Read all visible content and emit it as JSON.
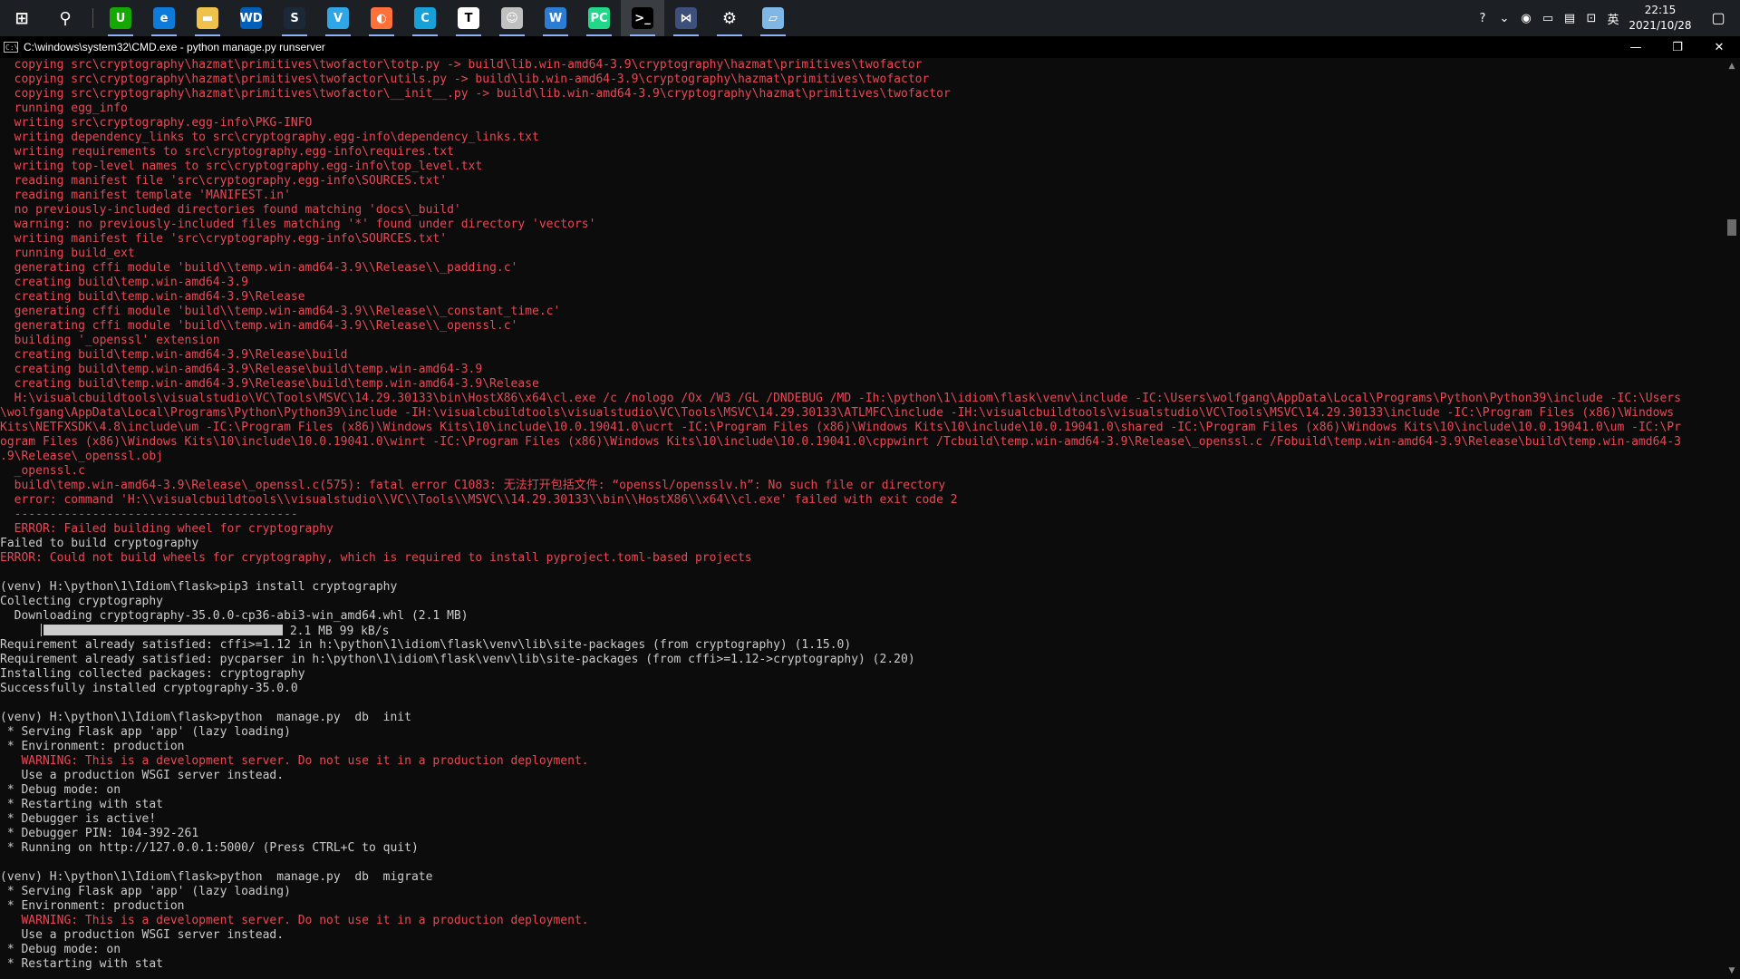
{
  "taskbar": {
    "apps": [
      {
        "name": "start",
        "glyph": "⊞",
        "color": "#1c1f24"
      },
      {
        "name": "search",
        "glyph": "⚲",
        "color": "#1c1f24"
      },
      {
        "name": "sep"
      },
      {
        "name": "upwork",
        "glyph": "U",
        "color": "#14a800"
      },
      {
        "name": "edge",
        "glyph": "e",
        "color": "#0c7bd9"
      },
      {
        "name": "file-explorer",
        "glyph": "▬",
        "color": "#f0c24b"
      },
      {
        "name": "wd",
        "glyph": "WD",
        "color": "#005fb8"
      },
      {
        "name": "steam",
        "glyph": "S",
        "color": "#1b2838"
      },
      {
        "name": "v-app",
        "glyph": "V",
        "color": "#2ea6e8"
      },
      {
        "name": "firefox-like",
        "glyph": "◐",
        "color": "#ff7139"
      },
      {
        "name": "c-app",
        "glyph": "C",
        "color": "#18a0d8"
      },
      {
        "name": "typora",
        "glyph": "T",
        "color": "#ffffff"
      },
      {
        "name": "photo-app",
        "glyph": "☺",
        "color": "#c0c0c0"
      },
      {
        "name": "word",
        "glyph": "W",
        "color": "#2b7cd3"
      },
      {
        "name": "pycharm",
        "glyph": "PC",
        "color": "#21d789"
      },
      {
        "name": "cmd",
        "glyph": ">_",
        "color": "#000000"
      },
      {
        "name": "vs-app",
        "glyph": "⋈",
        "color": "#3d4f7a"
      },
      {
        "name": "settings",
        "glyph": "⚙",
        "color": "#1c1f24"
      },
      {
        "name": "notes-app",
        "glyph": "▱",
        "color": "#7fb8e6"
      }
    ],
    "tray": {
      "help_glyph": "?",
      "chevron_glyph": "⌄",
      "steam_glyph": "◉",
      "usb_glyph": "▭",
      "battery_glyph": "▤",
      "network_glyph": "⊡",
      "ime": "英",
      "time": "22:15",
      "date": "2021/10/28",
      "notification_glyph": "▢"
    }
  },
  "window": {
    "title": "C:\\windows\\system32\\CMD.exe - python  manage.py runserver",
    "minimize": "—",
    "restore": "❐",
    "close": "✕"
  },
  "console": {
    "lines": [
      {
        "t": "  copying src\\cryptography\\hazmat\\primitives\\twofactor\\totp.py -> build\\lib.win-amd64-3.9\\cryptography\\hazmat\\primitives\\twofactor",
        "c": "red"
      },
      {
        "t": "  copying src\\cryptography\\hazmat\\primitives\\twofactor\\utils.py -> build\\lib.win-amd64-3.9\\cryptography\\hazmat\\primitives\\twofactor",
        "c": "red"
      },
      {
        "t": "  copying src\\cryptography\\hazmat\\primitives\\twofactor\\__init__.py -> build\\lib.win-amd64-3.9\\cryptography\\hazmat\\primitives\\twofactor",
        "c": "red"
      },
      {
        "t": "  running egg_info",
        "c": "red"
      },
      {
        "t": "  writing src\\cryptography.egg-info\\PKG-INFO",
        "c": "red"
      },
      {
        "t": "  writing dependency_links to src\\cryptography.egg-info\\dependency_links.txt",
        "c": "red"
      },
      {
        "t": "  writing requirements to src\\cryptography.egg-info\\requires.txt",
        "c": "red"
      },
      {
        "t": "  writing top-level names to src\\cryptography.egg-info\\top_level.txt",
        "c": "red"
      },
      {
        "t": "  reading manifest file 'src\\cryptography.egg-info\\SOURCES.txt'",
        "c": "red"
      },
      {
        "t": "  reading manifest template 'MANIFEST.in'",
        "c": "red"
      },
      {
        "t": "  no previously-included directories found matching 'docs\\_build'",
        "c": "red"
      },
      {
        "t": "  warning: no previously-included files matching '*' found under directory 'vectors'",
        "c": "red"
      },
      {
        "t": "  writing manifest file 'src\\cryptography.egg-info\\SOURCES.txt'",
        "c": "red"
      },
      {
        "t": "  running build_ext",
        "c": "red"
      },
      {
        "t": "  generating cffi module 'build\\\\temp.win-amd64-3.9\\\\Release\\\\_padding.c'",
        "c": "red"
      },
      {
        "t": "  creating build\\temp.win-amd64-3.9",
        "c": "red"
      },
      {
        "t": "  creating build\\temp.win-amd64-3.9\\Release",
        "c": "red"
      },
      {
        "t": "  generating cffi module 'build\\\\temp.win-amd64-3.9\\\\Release\\\\_constant_time.c'",
        "c": "red"
      },
      {
        "t": "  generating cffi module 'build\\\\temp.win-amd64-3.9\\\\Release\\\\_openssl.c'",
        "c": "red"
      },
      {
        "t": "  building '_openssl' extension",
        "c": "red"
      },
      {
        "t": "  creating build\\temp.win-amd64-3.9\\Release\\build",
        "c": "red"
      },
      {
        "t": "  creating build\\temp.win-amd64-3.9\\Release\\build\\temp.win-amd64-3.9",
        "c": "red"
      },
      {
        "t": "  creating build\\temp.win-amd64-3.9\\Release\\build\\temp.win-amd64-3.9\\Release",
        "c": "red"
      },
      {
        "t": "  H:\\visualcbuildtools\\visualstudio\\VC\\Tools\\MSVC\\14.29.30133\\bin\\HostX86\\x64\\cl.exe /c /nologo /Ox /W3 /GL /DNDEBUG /MD -Ih:\\python\\1\\idiom\\flask\\venv\\include -IC:\\Users\\wolfgang\\AppData\\Local\\Programs\\Python\\Python39\\include -IC:\\Users",
        "c": "red"
      },
      {
        "t": "\\wolfgang\\AppData\\Local\\Programs\\Python\\Python39\\include -IH:\\visualcbuildtools\\visualstudio\\VC\\Tools\\MSVC\\14.29.30133\\ATLMFC\\include -IH:\\visualcbuildtools\\visualstudio\\VC\\Tools\\MSVC\\14.29.30133\\include -IC:\\Program Files (x86)\\Windows",
        "c": "red"
      },
      {
        "t": "Kits\\NETFXSDK\\4.8\\include\\um -IC:\\Program Files (x86)\\Windows Kits\\10\\include\\10.0.19041.0\\ucrt -IC:\\Program Files (x86)\\Windows Kits\\10\\include\\10.0.19041.0\\shared -IC:\\Program Files (x86)\\Windows Kits\\10\\include\\10.0.19041.0\\um -IC:\\Pr",
        "c": "red"
      },
      {
        "t": "ogram Files (x86)\\Windows Kits\\10\\include\\10.0.19041.0\\winrt -IC:\\Program Files (x86)\\Windows Kits\\10\\include\\10.0.19041.0\\cppwinrt /Tcbuild\\temp.win-amd64-3.9\\Release\\_openssl.c /Fobuild\\temp.win-amd64-3.9\\Release\\build\\temp.win-amd64-3",
        "c": "red"
      },
      {
        "t": ".9\\Release\\_openssl.obj",
        "c": "red"
      },
      {
        "t": "  _openssl.c",
        "c": "red"
      },
      {
        "t": "  build\\temp.win-amd64-3.9\\Release\\_openssl.c(575): fatal error C1083: 无法打开包括文件: “openssl/opensslv.h”: No such file or directory",
        "c": "red"
      },
      {
        "t": "  error: command 'H:\\\\visualcbuildtools\\\\visualstudio\\\\VC\\\\Tools\\\\MSVC\\\\14.29.30133\\\\bin\\\\HostX86\\\\x64\\\\cl.exe' failed with exit code 2",
        "c": "red"
      },
      {
        "t": "  ----------------------------------------",
        "c": "red"
      },
      {
        "t": "  ERROR: Failed building wheel for cryptography",
        "c": "red"
      },
      {
        "t": "Failed to build cryptography",
        "c": "gray"
      },
      {
        "t": "ERROR: Could not build wheels for cryptography, which is required to install pyproject.toml-based projects",
        "c": "red"
      },
      {
        "t": "",
        "c": "gray"
      },
      {
        "t": "(venv) H:\\python\\1\\Idiom\\flask>pip3 install cryptography",
        "c": "gray"
      },
      {
        "t": "Collecting cryptography",
        "c": "gray"
      },
      {
        "t": "  Downloading cryptography-35.0.0-cp36-abi3-win_amd64.whl (2.1 MB)",
        "c": "gray"
      },
      {
        "t": "PROGRESS",
        "c": "gray",
        "progress_text": " 2.1 MB 99 kB/s",
        "progress_fraction": 1.0
      },
      {
        "t": "Requirement already satisfied: cffi>=1.12 in h:\\python\\1\\idiom\\flask\\venv\\lib\\site-packages (from cryptography) (1.15.0)",
        "c": "gray"
      },
      {
        "t": "Requirement already satisfied: pycparser in h:\\python\\1\\idiom\\flask\\venv\\lib\\site-packages (from cffi>=1.12->cryptography) (2.20)",
        "c": "gray"
      },
      {
        "t": "Installing collected packages: cryptography",
        "c": "gray"
      },
      {
        "t": "Successfully installed cryptography-35.0.0",
        "c": "gray"
      },
      {
        "t": "",
        "c": "gray"
      },
      {
        "t": "(venv) H:\\python\\1\\Idiom\\flask>python  manage.py  db  init",
        "c": "gray"
      },
      {
        "t": " * Serving Flask app 'app' (lazy loading)",
        "c": "gray"
      },
      {
        "t": " * Environment: production",
        "c": "gray"
      },
      {
        "t": "   WARNING: This is a development server. Do not use it in a production deployment.",
        "c": "red"
      },
      {
        "t": "   Use a production WSGI server instead.",
        "c": "gray"
      },
      {
        "t": " * Debug mode: on",
        "c": "gray"
      },
      {
        "t": " * Restarting with stat",
        "c": "gray"
      },
      {
        "t": " * Debugger is active!",
        "c": "gray"
      },
      {
        "t": " * Debugger PIN: 104-392-261",
        "c": "gray"
      },
      {
        "t": " * Running on http://127.0.0.1:5000/ (Press CTRL+C to quit)",
        "c": "gray"
      },
      {
        "t": "",
        "c": "gray"
      },
      {
        "t": "(venv) H:\\python\\1\\Idiom\\flask>python  manage.py  db  migrate",
        "c": "gray"
      },
      {
        "t": " * Serving Flask app 'app' (lazy loading)",
        "c": "gray"
      },
      {
        "t": " * Environment: production",
        "c": "gray"
      },
      {
        "t": "   WARNING: This is a development server. Do not use it in a production deployment.",
        "c": "red"
      },
      {
        "t": "   Use a production WSGI server instead.",
        "c": "gray"
      },
      {
        "t": " * Debug mode: on",
        "c": "gray"
      },
      {
        "t": " * Restarting with stat",
        "c": "gray"
      }
    ]
  },
  "scrollbar": {
    "up_glyph": "▲",
    "down_glyph": "▼"
  }
}
